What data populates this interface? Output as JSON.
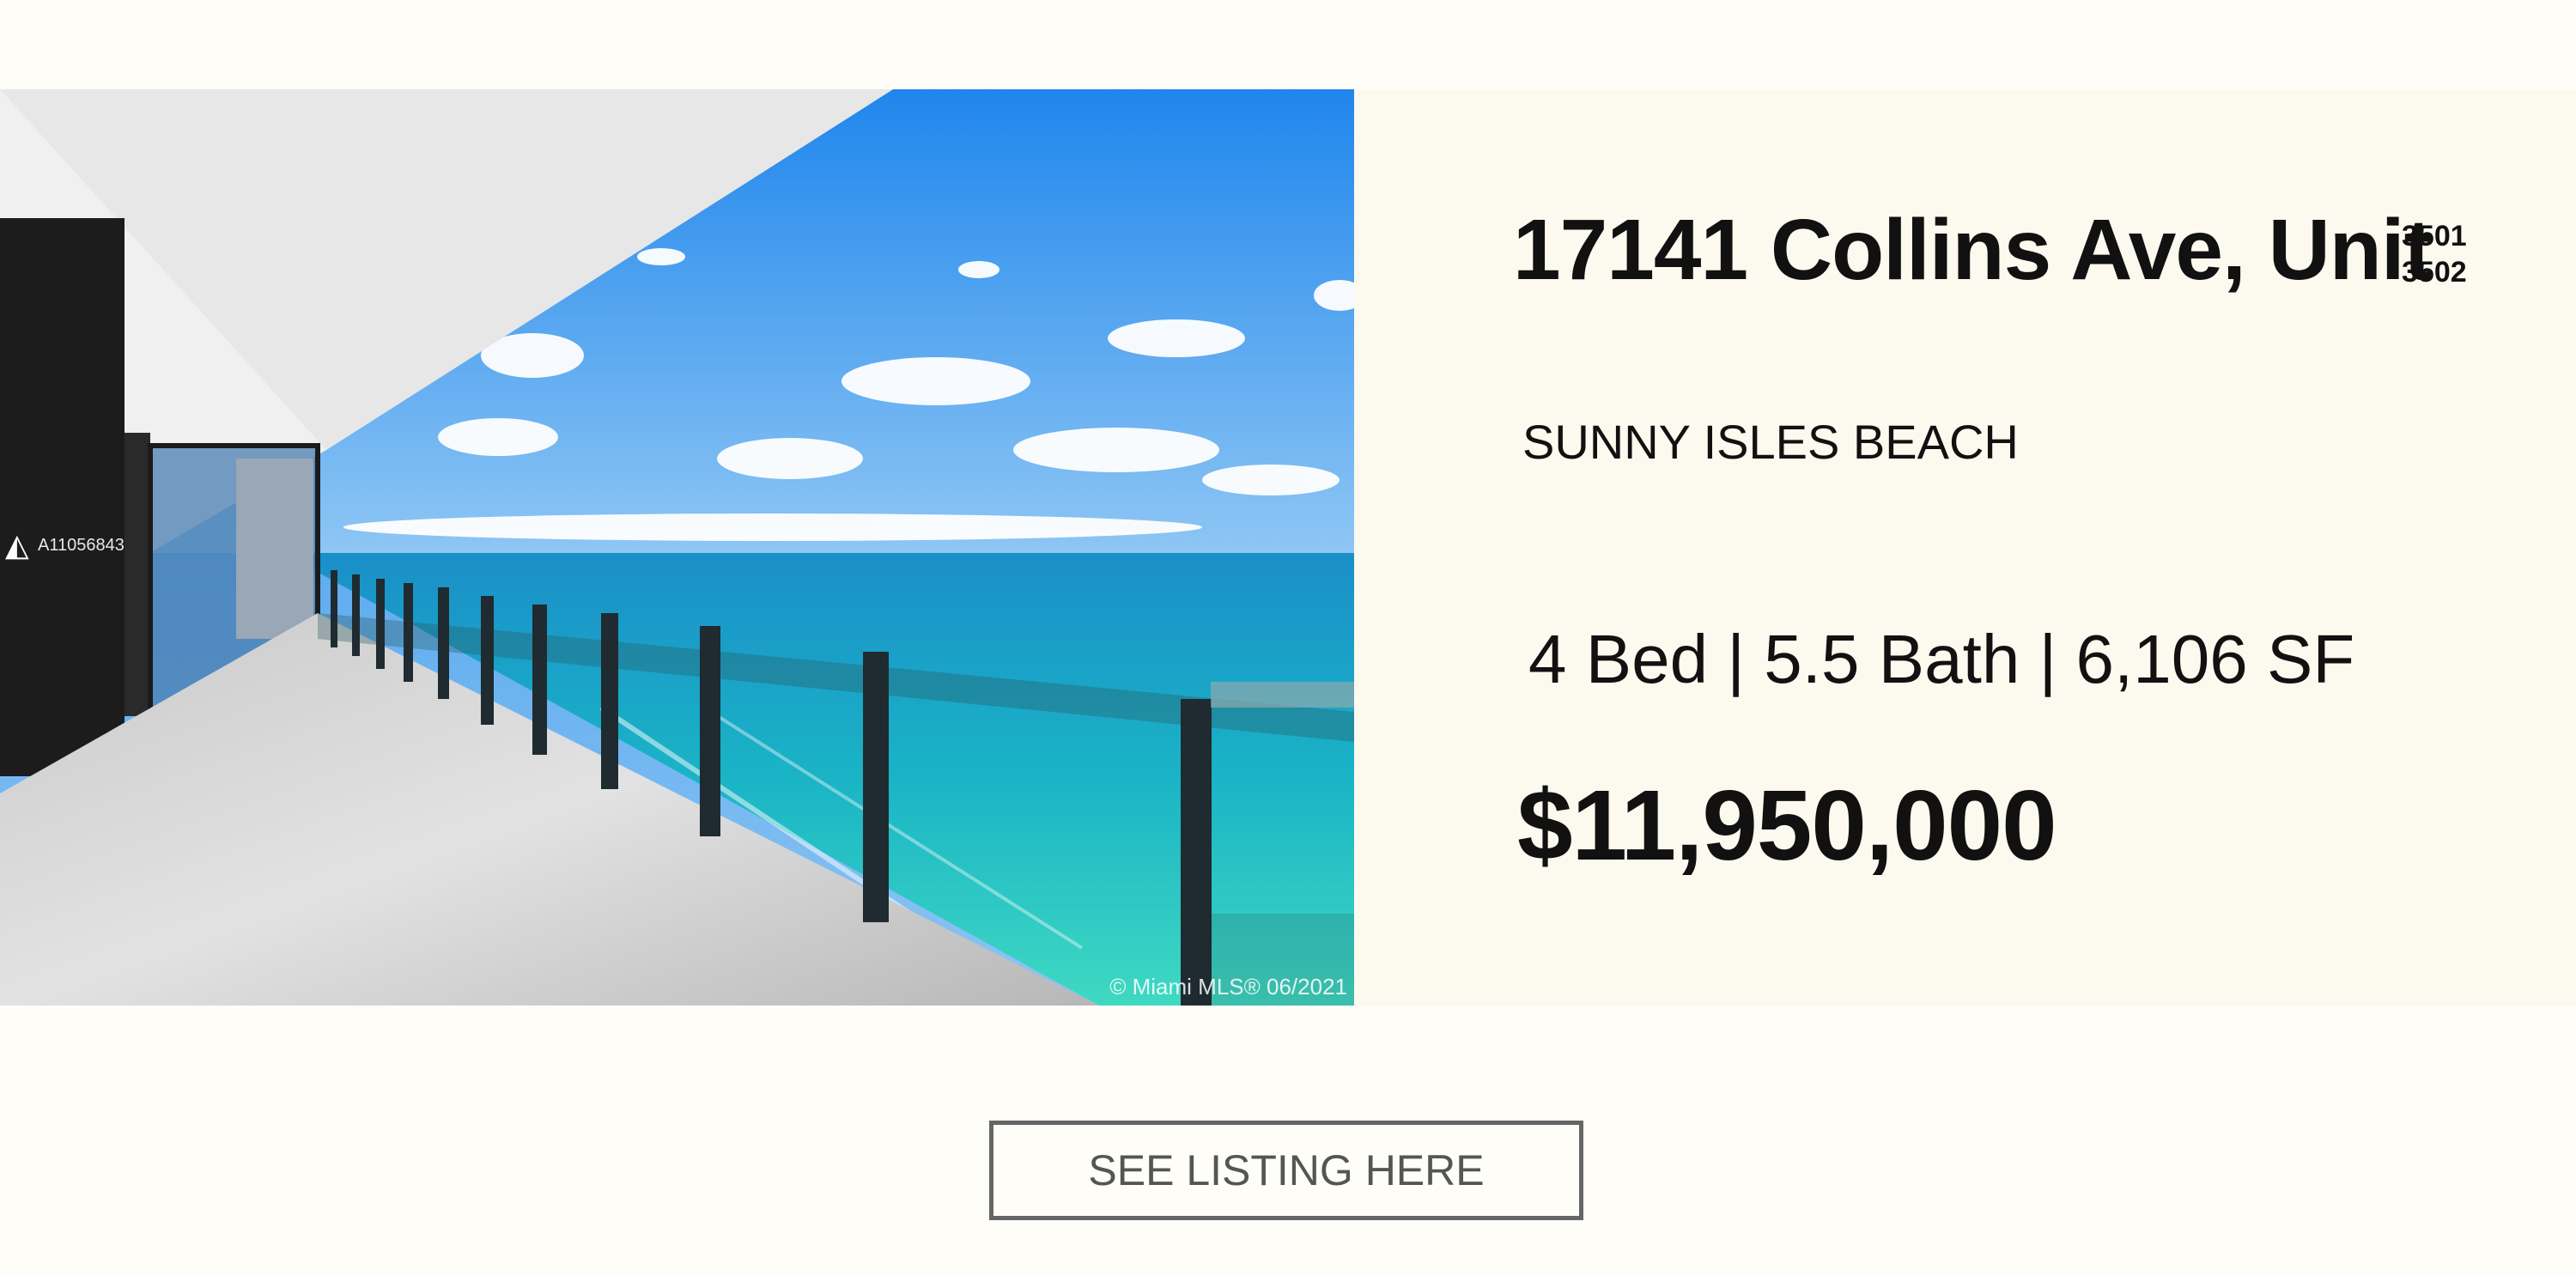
{
  "photo": {
    "alt_icon": "balcony-ocean-view-photo",
    "watermark_id": "A11056843",
    "copyright": "© Miami MLS® 06/2021"
  },
  "listing": {
    "address": "17141 Collins Ave, Unit",
    "units": [
      "3501",
      "3502"
    ],
    "city": "SUNNY ISLES BEACH",
    "stats": "4 Bed | 5.5 Bath | 6,106 SF",
    "price": "$11,950,000"
  },
  "cta": {
    "label": "SEE LISTING HERE"
  },
  "colors": {
    "background": "#fefdf8",
    "panel": "#fcf9ee",
    "text": "#111111",
    "button_border": "#666666"
  }
}
